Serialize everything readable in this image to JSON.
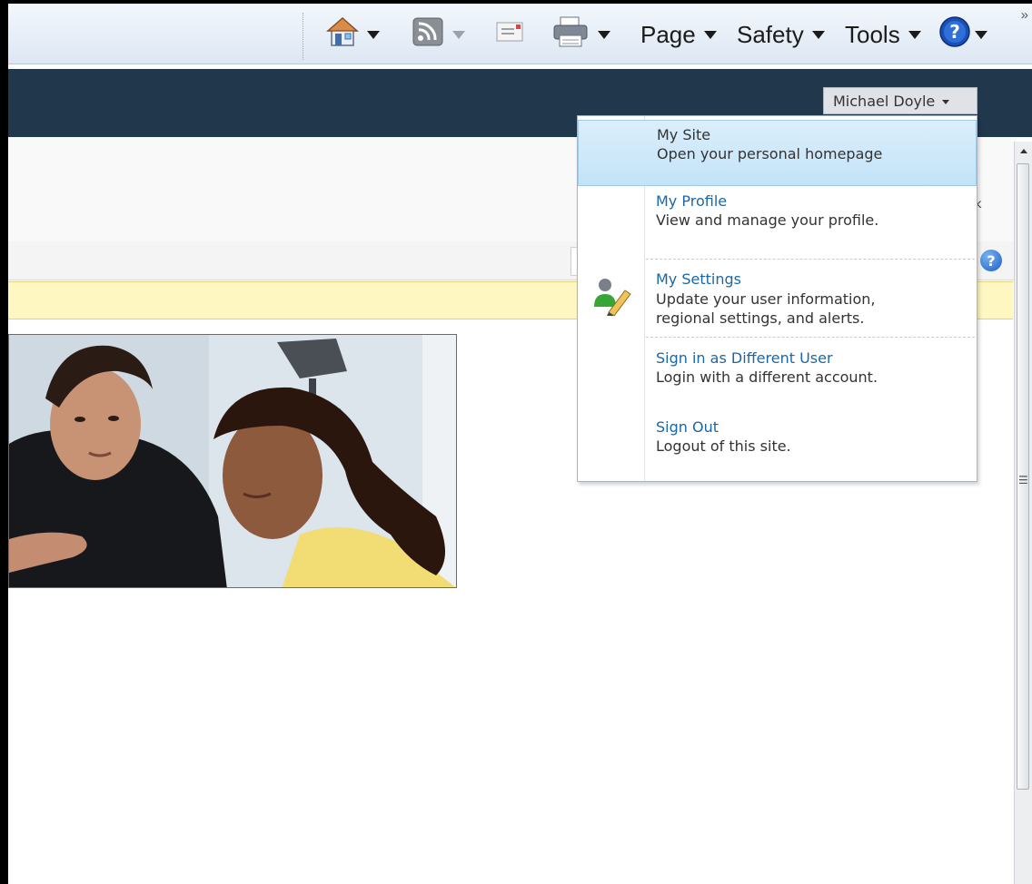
{
  "ie_toolbar": {
    "home_icon": "home-icon",
    "feeds_icon": "rss-feed-icon",
    "mail_icon": "read-mail-icon",
    "print_icon": "print-icon",
    "help_icon": "help-icon",
    "page_label": "Page",
    "safety_label": "Safety",
    "tools_label": "Tools",
    "more_chevron": "»"
  },
  "header": {
    "user_name": "Michael Doyle"
  },
  "user_menu": {
    "items": [
      {
        "title": "My Site",
        "desc": [
          "Open your personal homepage"
        ],
        "selected": true
      },
      {
        "title": "My Profile",
        "desc": [
          "View and manage your profile."
        ]
      },
      {
        "title": "My Settings",
        "desc": [
          "Update your user information,",
          "regional settings, and alerts."
        ],
        "icon": "user-settings-icon"
      },
      {
        "title": "Sign in as Different User",
        "desc": [
          "Login with a different account."
        ]
      },
      {
        "title": "Sign Out",
        "desc": [
          "Logout of this site."
        ]
      }
    ]
  },
  "ribbon": {
    "fragment_text": "k"
  },
  "colors": {
    "header_bg": "#21374c",
    "status_bar_yellow": "#fff7c2",
    "link_blue": "#1a67a8",
    "menu_selected": "#c3e3f8"
  }
}
